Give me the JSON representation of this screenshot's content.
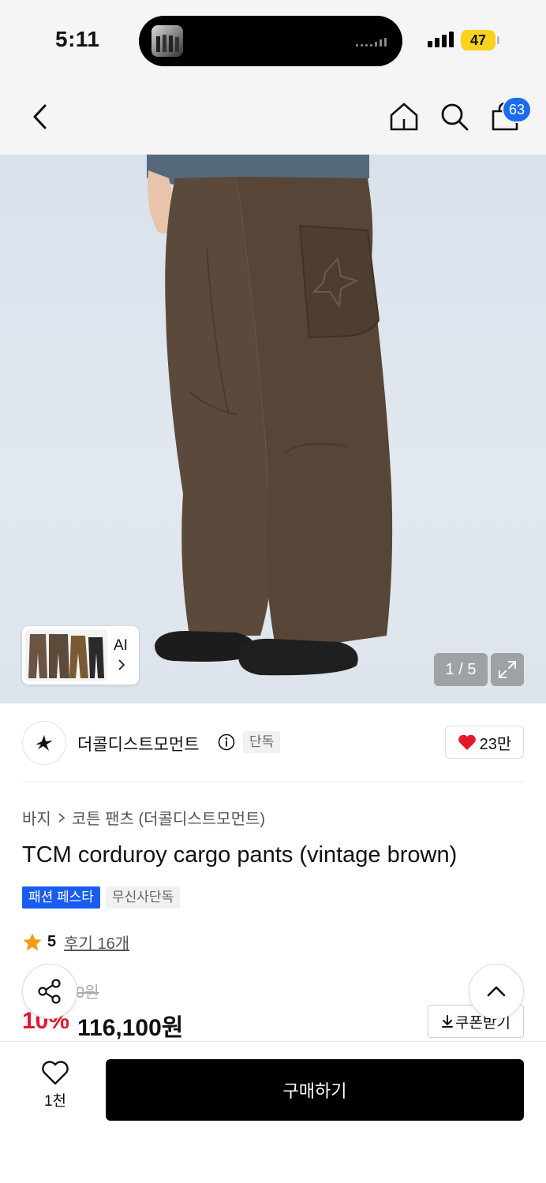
{
  "status_bar": {
    "time": "5:11",
    "battery": "47"
  },
  "nav": {
    "cart_count": "63"
  },
  "gallery": {
    "ai_label": "AI",
    "page_indicator": "1 / 5"
  },
  "brand": {
    "name": "더콜디스트모먼트",
    "tag": "단독",
    "likes": "23만"
  },
  "product": {
    "breadcrumb": [
      "바지",
      "코튼 팬츠 (더콜디스트모먼트)"
    ],
    "title": "TCM corduroy cargo pants (vintage brown)",
    "tags": [
      "패션 페스타",
      "무신사단독"
    ],
    "rating": "5",
    "review_link": "후기 16개",
    "original_price": "0원",
    "discount": "10%",
    "price": "116,100원",
    "coupon_label": "쿠폰받기"
  },
  "bottom_bar": {
    "wish_count": "1천",
    "buy_label": "구매하기"
  },
  "colors": {
    "accent_blue": "#1a5cf0",
    "discount_red": "#e5182d",
    "heart_red": "#e5182d",
    "star": "#f39c12"
  }
}
